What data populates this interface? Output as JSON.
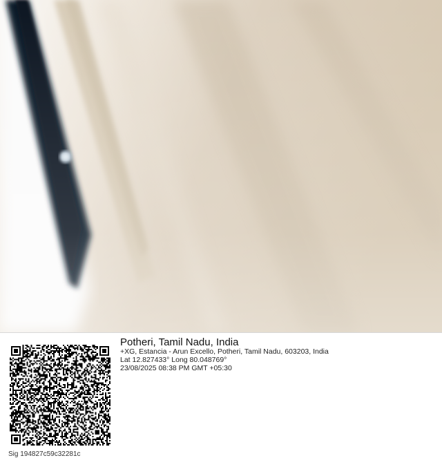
{
  "location": {
    "place": "Potheri, Tamil Nadu, India",
    "address": "+XG, Estancia - Arun Excello, Potheri, Tamil Nadu, 603203, India",
    "coordinates": "Lat 12.827433° Long 80.048769°",
    "timestamp": "23/08/2025 08:38 PM GMT +05:30"
  },
  "signature": "Sig 194827c59c32281c",
  "photo": {
    "subject": "blurred close-up of a dark device edge on a beige surface",
    "colors": {
      "wall": "#f5f2ee",
      "surface": "#d8ccb8",
      "device": "#0d1b2a"
    }
  }
}
